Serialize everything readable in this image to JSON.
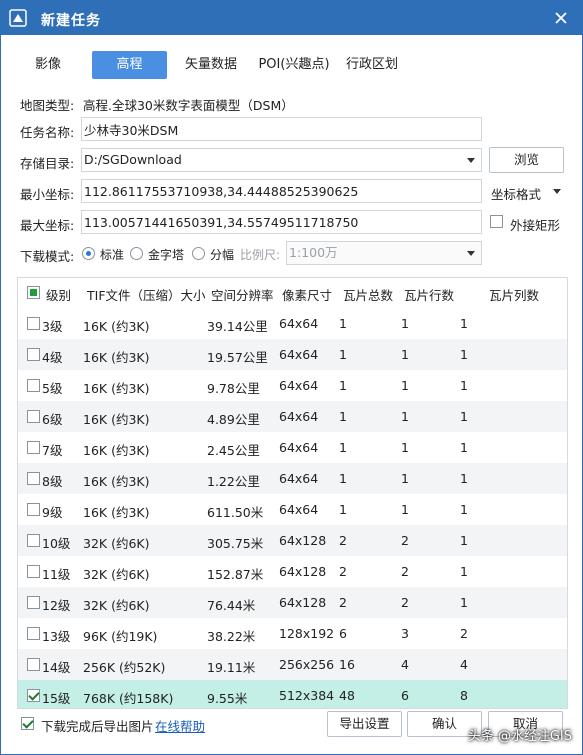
{
  "window": {
    "title": "新建任务"
  },
  "tabs": [
    {
      "label": "影像"
    },
    {
      "label": "高程"
    },
    {
      "label": "矢量数据"
    },
    {
      "label": "POI(兴趣点)"
    },
    {
      "label": "行政区划"
    }
  ],
  "form": {
    "map_type_label": "地图类型:",
    "map_type_value": "高程.全球30米数字表面模型（DSM）",
    "task_name_label": "任务名称:",
    "task_name_value": "少林寺30米DSM",
    "storage_label": "存储目录:",
    "storage_value": "D:/SGDownload",
    "browse_label": "浏览",
    "min_coord_label": "最小坐标:",
    "min_coord_value": "112.86117553710938,34.44488525390625",
    "coord_format_label": "坐标格式",
    "max_coord_label": "最大坐标:",
    "max_coord_value": "113.00571441650391,34.55749511718750",
    "bbox_label": "外接矩形",
    "mode_label": "下载模式:",
    "mode_standard": "标准",
    "mode_pyramid": "金字塔",
    "mode_split": "分幅",
    "scale_label": "比例尺:",
    "scale_value": "1:100万"
  },
  "table": {
    "headers": [
      "级别",
      "TIF文件（压缩）大小",
      "空间分辨率",
      "像素尺寸",
      "瓦片总数",
      "瓦片行数",
      "瓦片列数"
    ],
    "rows": [
      {
        "level": "3级",
        "size": "16K (约3K)",
        "res": "39.14公里",
        "px": "64x64",
        "total": "1",
        "rows": "1",
        "cols": "1",
        "checked": false
      },
      {
        "level": "4级",
        "size": "16K (约3K)",
        "res": "19.57公里",
        "px": "64x64",
        "total": "1",
        "rows": "1",
        "cols": "1",
        "checked": false
      },
      {
        "level": "5级",
        "size": "16K (约3K)",
        "res": "9.78公里",
        "px": "64x64",
        "total": "1",
        "rows": "1",
        "cols": "1",
        "checked": false
      },
      {
        "level": "6级",
        "size": "16K (约3K)",
        "res": "4.89公里",
        "px": "64x64",
        "total": "1",
        "rows": "1",
        "cols": "1",
        "checked": false
      },
      {
        "level": "7级",
        "size": "16K (约3K)",
        "res": "2.45公里",
        "px": "64x64",
        "total": "1",
        "rows": "1",
        "cols": "1",
        "checked": false
      },
      {
        "level": "8级",
        "size": "16K (约3K)",
        "res": "1.22公里",
        "px": "64x64",
        "total": "1",
        "rows": "1",
        "cols": "1",
        "checked": false
      },
      {
        "level": "9级",
        "size": "16K (约3K)",
        "res": "611.50米",
        "px": "64x64",
        "total": "1",
        "rows": "1",
        "cols": "1",
        "checked": false
      },
      {
        "level": "10级",
        "size": "32K (约6K)",
        "res": "305.75米",
        "px": "64x128",
        "total": "2",
        "rows": "2",
        "cols": "1",
        "checked": false
      },
      {
        "level": "11级",
        "size": "32K (约6K)",
        "res": "152.87米",
        "px": "64x128",
        "total": "2",
        "rows": "2",
        "cols": "1",
        "checked": false
      },
      {
        "level": "12级",
        "size": "32K (约6K)",
        "res": "76.44米",
        "px": "64x128",
        "total": "2",
        "rows": "2",
        "cols": "1",
        "checked": false
      },
      {
        "level": "13级",
        "size": "96K (约19K)",
        "res": "38.22米",
        "px": "128x192",
        "total": "6",
        "rows": "3",
        "cols": "2",
        "checked": false
      },
      {
        "level": "14级",
        "size": "256K (约52K)",
        "res": "19.11米",
        "px": "256x256",
        "total": "16",
        "rows": "4",
        "cols": "4",
        "checked": false
      },
      {
        "level": "15级",
        "size": "768K (约158K)",
        "res": "9.55米",
        "px": "512x384",
        "total": "48",
        "rows": "6",
        "cols": "8",
        "checked": true
      }
    ]
  },
  "footer": {
    "export_after_label": "下载完成后导出图片",
    "help_link": "在线帮助",
    "export_settings": "导出设置",
    "confirm": "确认",
    "cancel": "取消"
  },
  "watermark": "头条 @水经注GIS",
  "colors": {
    "titlebar": "#2f6fb8",
    "active_tab": "#4a8fe2",
    "selected_row": "#c4efe6"
  }
}
